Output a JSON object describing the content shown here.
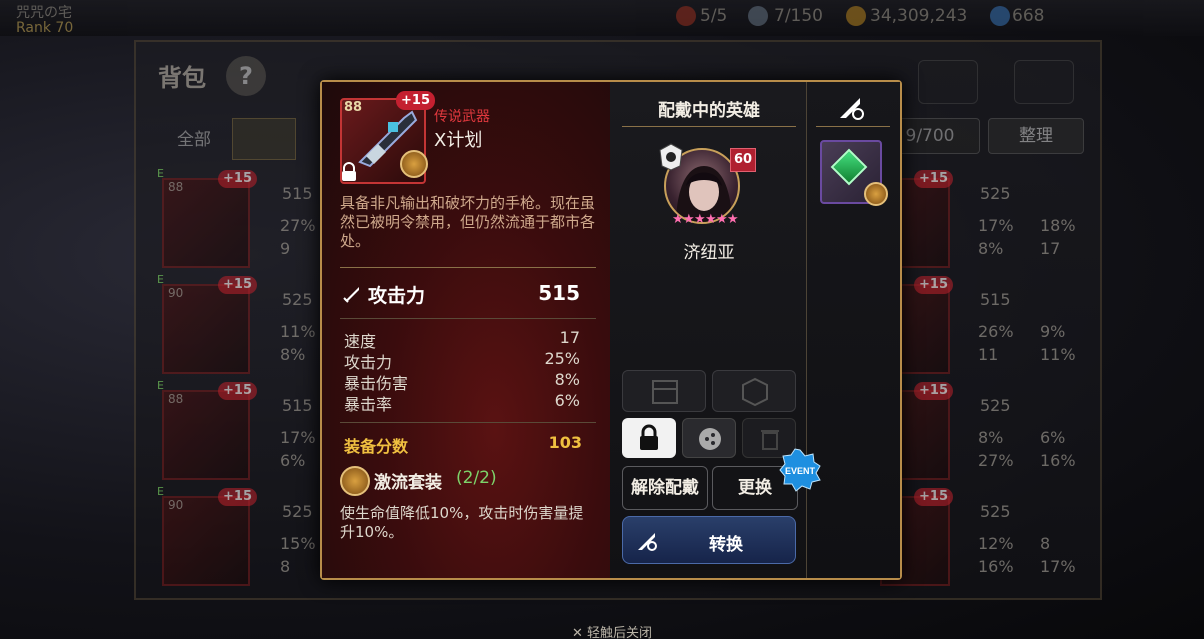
{
  "background": {
    "top_bar": {
      "player_name": "咒咒の宅",
      "rank": "Rank 70",
      "stamina": "5/5",
      "friendship": "7/150",
      "gold": "34,309,243",
      "crystals": "668"
    },
    "bag": {
      "title": "背包",
      "help_glyph": "?",
      "tab_all": "全部",
      "capacity": "9/700",
      "sort_label": "整理",
      "left_cards": [
        {
          "level": "88",
          "plus": "+15",
          "grade": "E",
          "stats": [
            "515",
            "27%",
            "9"
          ]
        },
        {
          "level": "90",
          "plus": "+15",
          "grade": "E",
          "stats": [
            "525",
            "11%",
            "8%"
          ]
        },
        {
          "level": "88",
          "plus": "+15",
          "grade": "E",
          "stats": [
            "515",
            "17%",
            "6%"
          ]
        },
        {
          "level": "90",
          "plus": "+15",
          "grade": "E",
          "stats": [
            "525",
            "15%",
            "8"
          ]
        }
      ],
      "right_cards": [
        {
          "plus": "+15",
          "stats": [
            "525",
            "17%",
            "18%",
            "8%",
            "17"
          ]
        },
        {
          "plus": "+15",
          "stats": [
            "515",
            "26%",
            "9%",
            "11",
            "11%"
          ]
        },
        {
          "plus": "+15",
          "stats": [
            "525",
            "8%",
            "6%",
            "27%",
            "16%"
          ]
        },
        {
          "plus": "+15",
          "stats": [
            "525",
            "12%",
            "8",
            "16%",
            "17%"
          ]
        }
      ]
    },
    "close_hint": "轻触后关闭"
  },
  "item": {
    "level": "88",
    "enhance": "+15",
    "grade_label": "传说武器",
    "name": "X计划",
    "description": "具备非凡输出和破坏力的手枪。现在虽然已被明令禁用，但仍然流通于都市各处。",
    "main_stat": {
      "label": "攻击力",
      "value": "515"
    },
    "sub_stats": [
      {
        "label": "速度",
        "value": "17"
      },
      {
        "label": "攻击力",
        "value": "25%"
      },
      {
        "label": "暴击伤害",
        "value": "8%"
      },
      {
        "label": "暴击率",
        "value": "6%"
      }
    ],
    "score_label": "装备分数",
    "score_value": "103",
    "set_name": "激流套装",
    "set_count": "(2/2)",
    "set_effect": "使生命值降低10%，攻击时伤害量提升10%。"
  },
  "equipped": {
    "title": "配戴中的英雄",
    "hero_level": "60",
    "hero_name": "济纽亚",
    "stars": 6,
    "unequip_label": "解除配戴",
    "change_label": "更换",
    "event_badge": "EVENT",
    "convert_label": "转换"
  },
  "colors": {
    "gold_border": "#b88d4a",
    "grade_red": "#e0383d",
    "score_yellow": "#f0c040",
    "set_green": "#7dd36a",
    "convert_blue": "#2a3f6a"
  }
}
